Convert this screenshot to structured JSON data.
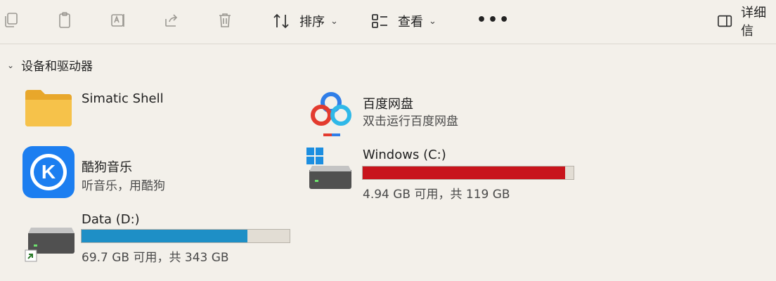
{
  "toolbar": {
    "sort_label": "排序",
    "view_label": "查看",
    "more_label": "•••",
    "details_label": "详细信"
  },
  "section": {
    "title": "设备和驱动器"
  },
  "items": {
    "simatic": {
      "name": "Simatic Shell"
    },
    "baidu": {
      "name": "百度网盘",
      "subtitle": "双击运行百度网盘"
    },
    "kugou": {
      "name": "酷狗音乐",
      "subtitle": "听音乐，用酷狗",
      "icon_letter": "K"
    },
    "windows": {
      "name": "Windows (C:)",
      "space": "4.94 GB 可用，共 119 GB",
      "used_fraction": 0.959,
      "bar_color": "#c8141c"
    },
    "data": {
      "name": "Data (D:)",
      "space": "69.7 GB 可用，共 343 GB",
      "used_fraction": 0.797,
      "bar_color": "#1e8fc6"
    }
  }
}
